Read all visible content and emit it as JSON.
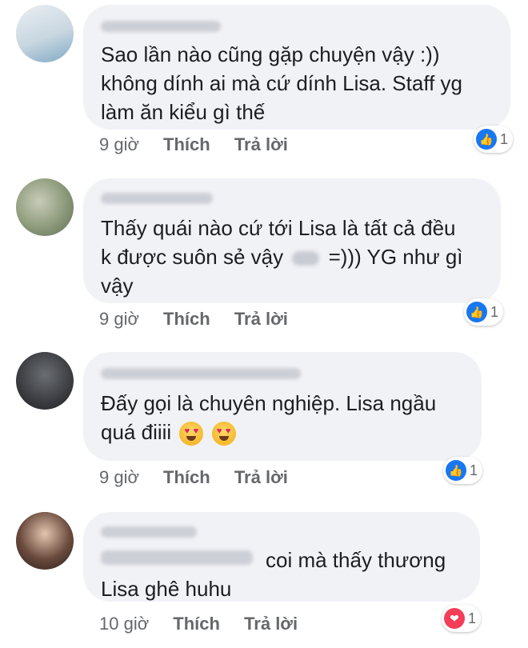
{
  "comments": [
    {
      "lines": [
        "Sao lần nào cũng gặp chuyện vậy :))",
        "không dính ai mà cứ dính Lisa. Staff yg",
        "làm ăn kiểu gì thế"
      ],
      "time": "9 giờ",
      "like_label": "Thích",
      "reply_label": "Trả lời",
      "reaction": {
        "type": "like",
        "icon": "thumbs-up-icon",
        "color": "#1877f2",
        "count": "1"
      }
    },
    {
      "lines": [
        "Thấy quái nào cứ tới Lisa là tất cả đều",
        "k được suôn sẻ vậy",
        "=))) YG như gì",
        "vậy"
      ],
      "time": "9 giờ",
      "like_label": "Thích",
      "reply_label": "Trả lời",
      "reaction": {
        "type": "like",
        "icon": "thumbs-up-icon",
        "color": "#1877f2",
        "count": "1"
      }
    },
    {
      "lines": [
        "Đấy gọi là chuyên nghiệp. Lisa ngầu",
        "quá điiii"
      ],
      "time": "9 giờ",
      "like_label": "Thích",
      "reply_label": "Trả lời",
      "emojis": [
        "heart-eyes-emoji",
        "heart-eyes-emoji"
      ],
      "reaction": {
        "type": "like",
        "icon": "thumbs-up-icon",
        "color": "#1877f2",
        "count": "1"
      }
    },
    {
      "lines": [
        "coi mà thấy thương",
        "Lisa ghê huhu"
      ],
      "time": "10 giờ",
      "like_label": "Thích",
      "reply_label": "Trả lời",
      "reaction": {
        "type": "love",
        "icon": "heart-icon",
        "color": "#f33e58",
        "count": "1"
      }
    }
  ]
}
